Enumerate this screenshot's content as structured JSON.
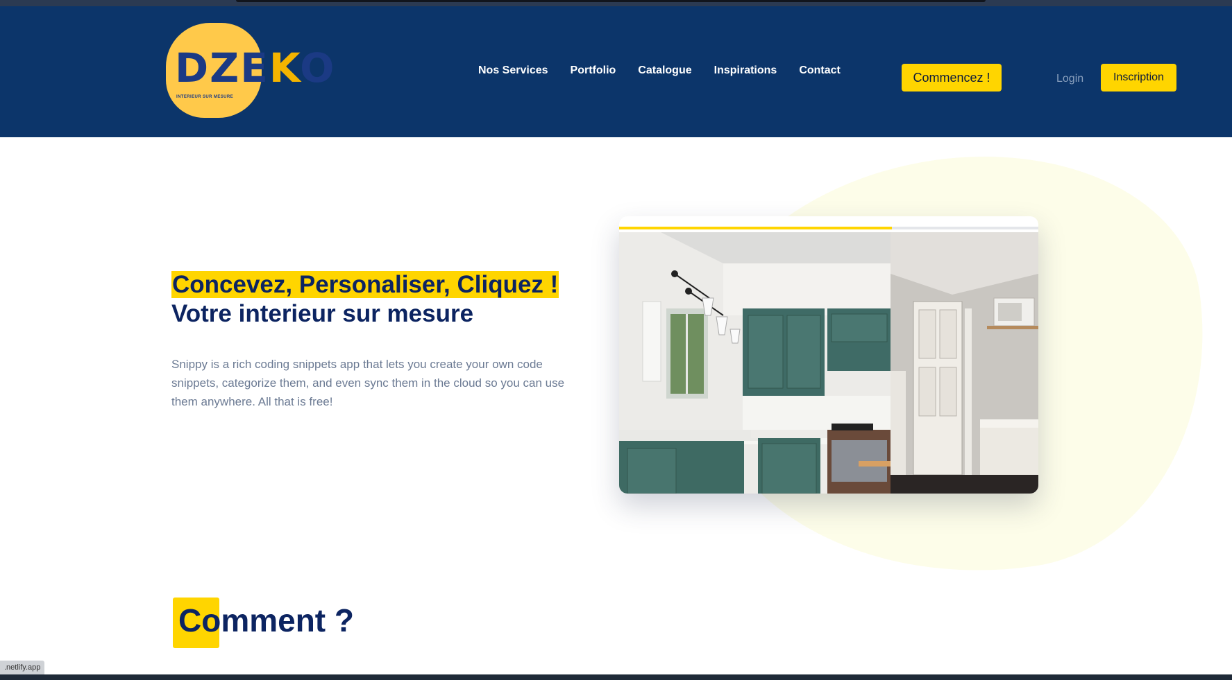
{
  "header": {
    "logo": {
      "text_main": "DZE",
      "text_accent": "K",
      "text_end": "O",
      "tagline": "INTERIEUR SUR MESURE"
    },
    "nav": [
      "Nos Services",
      "Portfolio",
      "Catalogue",
      "Inspirations",
      "Contact"
    ],
    "cta_label": "Commencez !",
    "login_label": "Login",
    "signup_label": "Inscription"
  },
  "hero": {
    "title_highlight": "Concevez, Personaliser, Cliquez !",
    "title_line2": "Votre interieur sur mesure",
    "description": "Snippy is a rich coding snippets app that lets you create your own code snippets, categorize them, and even sync them in the cloud so you can use them anywhere. All that is free!",
    "carousel_progress": 0.65
  },
  "section": {
    "title": "Comment ?"
  },
  "status_tip": ".netlify.app",
  "colors": {
    "header_bg": "#0c356a",
    "accent": "#ffd500",
    "heading": "#0c2461",
    "text_muted": "#6b7a93"
  }
}
